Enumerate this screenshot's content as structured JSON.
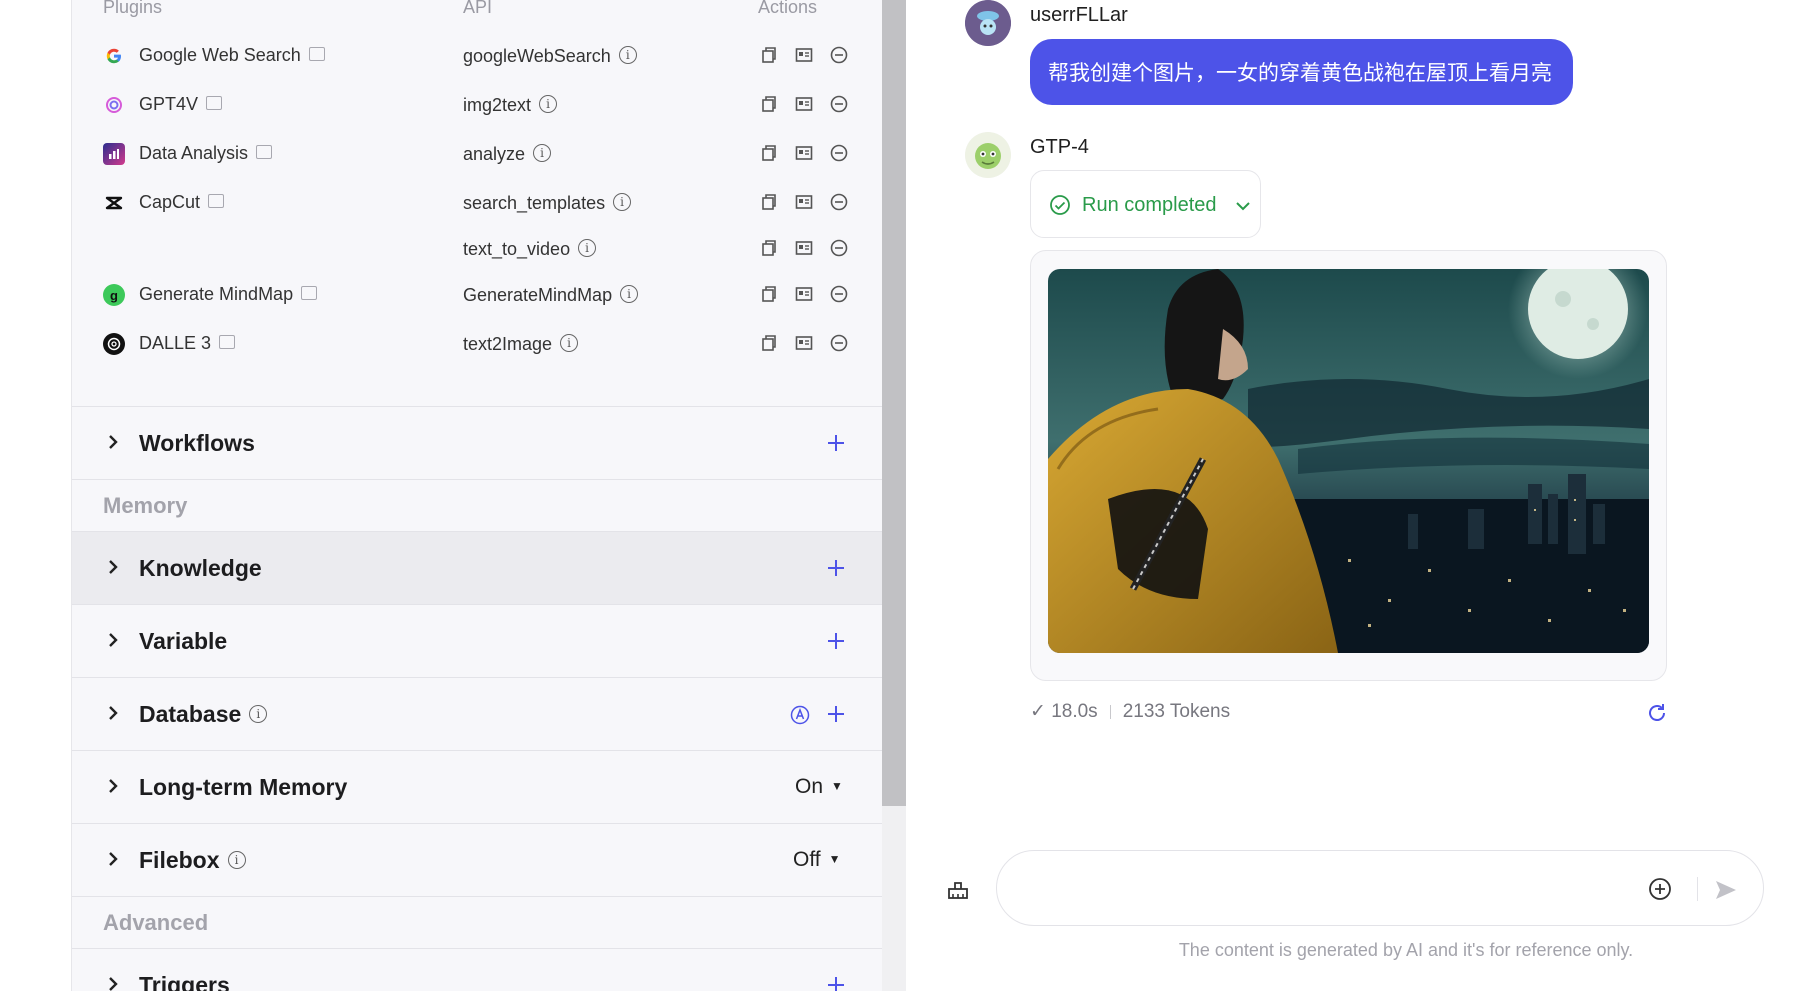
{
  "plugins_table": {
    "headers": {
      "plugins": "Plugins",
      "api": "API",
      "actions": "Actions"
    },
    "rows": [
      {
        "name": "Google Web Search",
        "api": "googleWebSearch",
        "icon": "google-icon"
      },
      {
        "name": "GPT4V",
        "api": "img2text",
        "icon": "openai-swirl-icon"
      },
      {
        "name": "Data Analysis",
        "api": "analyze",
        "icon": "data-analysis-icon"
      },
      {
        "name": "CapCut",
        "api": "search_templates",
        "icon": "capcut-icon"
      },
      {
        "name": "",
        "api": "text_to_video",
        "icon": ""
      },
      {
        "name": "Generate MindMap",
        "api": "GenerateMindMap",
        "icon": "mindmap-icon",
        "icon_letter": "g"
      },
      {
        "name": "DALLE 3",
        "api": "text2Image",
        "icon": "openai-icon"
      }
    ]
  },
  "sections": {
    "workflows": "Workflows",
    "memory_group": "Memory",
    "knowledge": "Knowledge",
    "variable": "Variable",
    "database": "Database",
    "long_term_memory": "Long-term Memory",
    "long_term_memory_value": "On",
    "filebox": "Filebox",
    "filebox_value": "Off",
    "advanced_group": "Advanced",
    "triggers": "Triggers"
  },
  "chat": {
    "user_name": "userrFLLar",
    "user_message": "帮我创建个图片，一女的穿着黄色战袍在屋顶上看月亮",
    "bot_name": "GTP-4",
    "run_status": "Run completed",
    "duration": "18.0s",
    "tokens": "2133 Tokens",
    "input_value": "",
    "disclaimer": "The content is generated by AI and it's for reference only."
  },
  "colors": {
    "accent": "#4d53e8",
    "success": "#2a9b4a",
    "panel_bg": "#f7f7fa",
    "highlight_row": "#ebebef"
  }
}
